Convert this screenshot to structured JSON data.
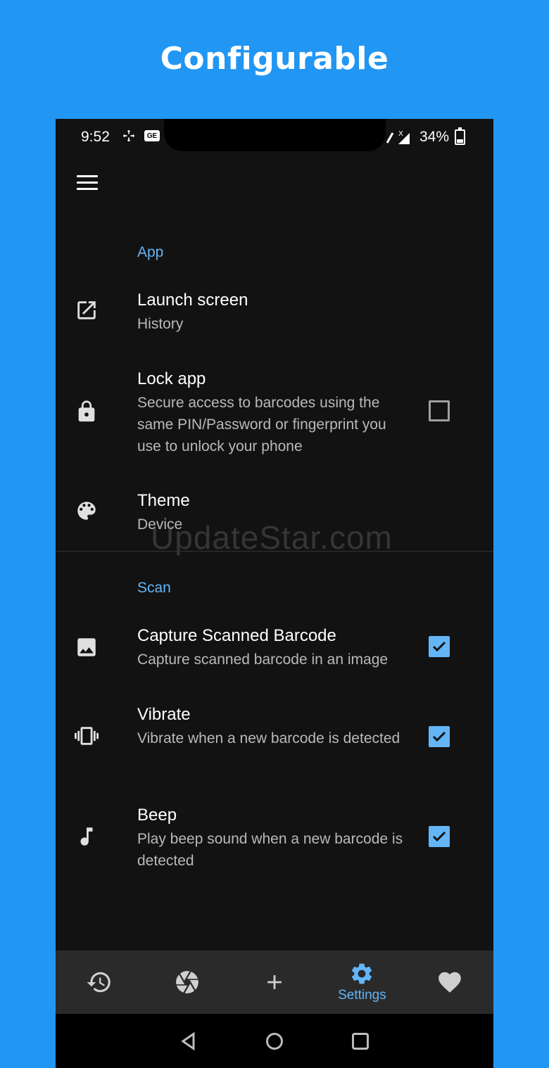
{
  "headline": "Configurable",
  "status_bar": {
    "time": "9:52",
    "battery_percent": "34%",
    "network_badge": "GE"
  },
  "colors": {
    "background": "#2196f3",
    "accent": "#64b5f6",
    "surface": "#121212",
    "nav_bar": "#2a2a2a"
  },
  "sections": {
    "app": "App",
    "scan": "Scan"
  },
  "settings": {
    "launch_screen": {
      "title": "Launch screen",
      "summary": "History",
      "icon": "open-in-new-icon"
    },
    "lock_app": {
      "title": "Lock app",
      "summary": "Secure access to barcodes using the same PIN/Password or fingerprint you use to unlock your phone",
      "checked": false,
      "icon": "lock-icon"
    },
    "theme": {
      "title": "Theme",
      "summary": "Device",
      "icon": "palette-icon"
    },
    "capture": {
      "title": "Capture Scanned Barcode",
      "summary": "Capture scanned barcode in an image",
      "checked": true,
      "icon": "image-icon"
    },
    "vibrate": {
      "title": "Vibrate",
      "summary": "Vibrate when a new barcode is detected",
      "checked": true,
      "icon": "vibration-icon"
    },
    "beep": {
      "title": "Beep",
      "summary": "Play beep sound when a new barcode is detected",
      "checked": true,
      "icon": "music-note-icon"
    }
  },
  "watermark": "UpdateStar.com",
  "bottom_nav": {
    "settings_label": "Settings",
    "items": [
      "history-icon",
      "camera-shutter-icon",
      "plus-icon",
      "gear-icon",
      "heart-icon"
    ],
    "active": "Settings"
  }
}
